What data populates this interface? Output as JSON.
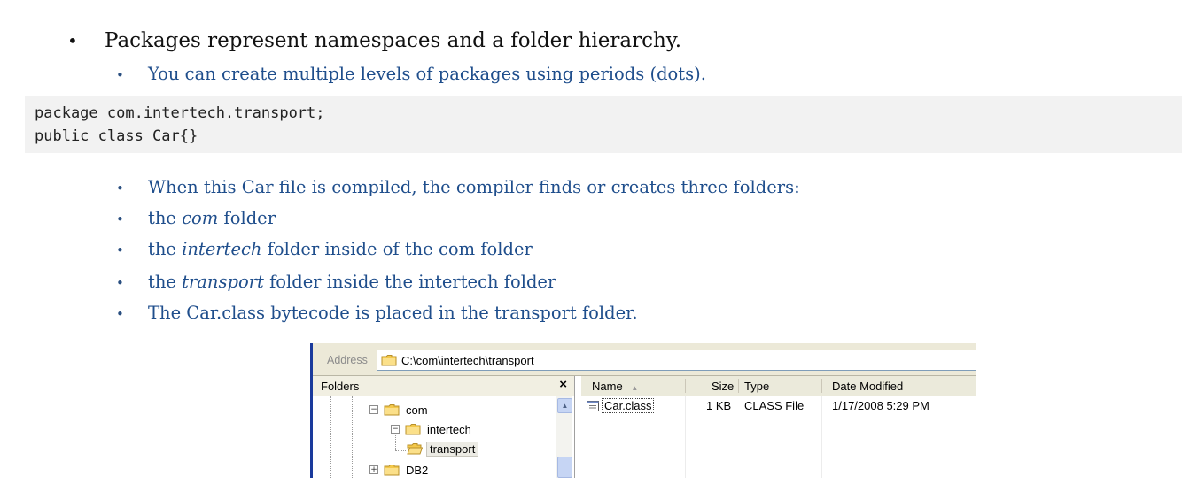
{
  "slide": {
    "bullets_level1": [
      {
        "text": "Packages represent namespaces and a folder hierarchy."
      }
    ],
    "bullets_level2_top": [
      {
        "text": "You can create multiple levels of packages using periods (dots)."
      }
    ],
    "code_lines": [
      "package com.intertech.transport;",
      "public class Car{}"
    ],
    "bullets_level2_bottom": [
      {
        "pre": "When this Car file is compiled, the compiler finds or creates three folders:",
        "em": "",
        "post": ""
      },
      {
        "pre": "the ",
        "em": "com",
        "post": " folder"
      },
      {
        "pre": "the ",
        "em": "intertech",
        "post": " folder inside of the com folder"
      },
      {
        "pre": "the ",
        "em": "transport",
        "post": " folder inside the intertech folder"
      },
      {
        "pre": "The Car.class bytecode is placed in the transport folder.",
        "em": "",
        "post": ""
      }
    ],
    "bullet_char": "•"
  },
  "explorer": {
    "address_label": "Address",
    "address_path": "C:\\com\\intertech\\transport",
    "folders_title": "Folders",
    "close_glyph": "×",
    "tree": [
      {
        "label": "com",
        "toggle": "−"
      },
      {
        "label": "intertech",
        "toggle": "−"
      },
      {
        "label": "transport",
        "toggle": ""
      },
      {
        "label": "DB2",
        "toggle": "+"
      }
    ],
    "columns": {
      "name": "Name",
      "sort_glyph": "▲",
      "size": "Size",
      "type": "Type",
      "date": "Date Modified"
    },
    "files": [
      {
        "name": "Car.class",
        "size": "1 KB",
        "type": "CLASS File",
        "date": "1/17/2008 5:29 PM"
      }
    ],
    "scroll_up_glyph": "▲"
  },
  "colors": {
    "level1_text": "#111111",
    "level2_text": "#1f4e8c",
    "code_bg": "#f2f2f2",
    "folder_yellow": "#f3c84b",
    "explorer_frame": "#1a3a9c"
  }
}
